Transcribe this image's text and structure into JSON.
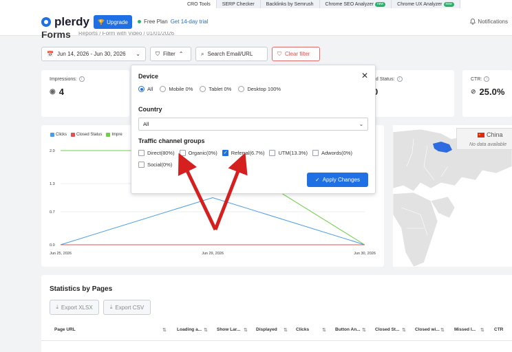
{
  "toolbar": {
    "tabs": [
      {
        "label": "CRO Tools",
        "new": false
      },
      {
        "label": "SERP Checker",
        "new": false
      },
      {
        "label": "Backlinks by Semrush",
        "new": false
      },
      {
        "label": "Chrome SEO Analyzer",
        "new": true
      },
      {
        "label": "Chrome UX Analyzer",
        "new": true
      }
    ],
    "new_badge": "new"
  },
  "header": {
    "logo": "plerdy",
    "upgrade_label": "Upgrade",
    "plan_label": "Free Plan",
    "trial_link": "Get 14-day trial",
    "notifications_label": "Notifications"
  },
  "page": {
    "title": "Forms",
    "breadcrumb": "Reports / Form with Video / 01/01/2026"
  },
  "filters": {
    "date_range": "Jun 14, 2026 - Jun 30, 2026",
    "filter_label": "Filter",
    "search_label": "Search Email/URL",
    "clear_label": "Clear filter"
  },
  "stats": [
    {
      "label": "Impressions:",
      "value": "4",
      "icon": "eye-icon"
    },
    {
      "label": "ed Status:",
      "value": "0",
      "icon": ""
    },
    {
      "label": "CTR:",
      "value": "25.0%",
      "icon": "check-circle-icon"
    }
  ],
  "chart_data": {
    "type": "line",
    "legend": [
      "Clicks",
      "Closed Status",
      "Impressions"
    ],
    "legend_visible": [
      "Clicks",
      "Closed Status",
      "Impre"
    ],
    "x": [
      "Jun 25, 2026",
      "Jun 29, 2026",
      "Jun 30, 2026"
    ],
    "yticks": [
      "2.0",
      "1.3",
      "0.7",
      "0.0"
    ],
    "ylim": [
      0,
      2
    ],
    "series": [
      {
        "name": "Clicks",
        "color": "#4a9be8",
        "values": [
          0,
          1,
          0
        ]
      },
      {
        "name": "Closed Status",
        "color": "#e05252",
        "values": [
          0,
          0,
          0
        ]
      },
      {
        "name": "Impressions",
        "color": "#6fcf4a",
        "values": [
          2,
          2,
          0
        ]
      }
    ]
  },
  "map": {
    "country": "China",
    "nodata": "No data available"
  },
  "statistics": {
    "title": "Statistics by Pages",
    "export_xlsx": "Export XLSX",
    "export_csv": "Export CSV",
    "columns": [
      "Page URL",
      "Loading a...",
      "Show Lar...",
      "Displayed",
      "Clicks",
      "Button An...",
      "Closed St...",
      "Closed wi...",
      "Missed I...",
      "CTR"
    ]
  },
  "popup": {
    "device_heading": "Device",
    "device_options": [
      {
        "label": "All",
        "selected": true
      },
      {
        "label": "Mobile 0%",
        "selected": false
      },
      {
        "label": "Tablet 0%",
        "selected": false
      },
      {
        "label": "Desktop 100%",
        "selected": false
      }
    ],
    "country_heading": "Country",
    "country_value": "All",
    "traffic_heading": "Traffic channel groups",
    "traffic_options": [
      {
        "label": "Direct(80%)",
        "checked": false
      },
      {
        "label": "Organic(0%)",
        "checked": false
      },
      {
        "label": "Referral(6.7%)",
        "checked": true
      },
      {
        "label": "UTM(13.3%)",
        "checked": false
      },
      {
        "label": "Adwords(0%)",
        "checked": false
      },
      {
        "label": "Social(0%)",
        "checked": false
      }
    ],
    "apply_label": "Apply Changes"
  }
}
